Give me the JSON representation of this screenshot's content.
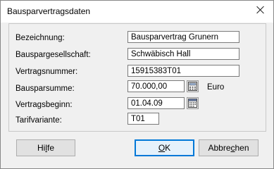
{
  "window": {
    "title": "Bausparvertragsdaten"
  },
  "fields": [
    {
      "label": "Bezeichnung:",
      "value": "Bausparvertrag Grunern"
    },
    {
      "label": "Bauspargesellschaft:",
      "value": "Schwäbisch Hall"
    },
    {
      "label": "Vertragsnummer:",
      "value": "15915383T01"
    },
    {
      "label": "Bausparsumme:",
      "value": "70.000,00",
      "unit": "Euro"
    },
    {
      "label": "Vertragsbeginn:",
      "value": "01.04.09"
    },
    {
      "label": "Tarifvariante:",
      "value": "T01"
    }
  ],
  "buttons": {
    "help": {
      "pre": "Hi",
      "key": "l",
      "post": "fe"
    },
    "ok": {
      "pre": "",
      "key": "O",
      "post": "K"
    },
    "cancel": {
      "pre": "Abbre",
      "key": "c",
      "post": "hen"
    }
  },
  "icons": {
    "close": "close-icon",
    "calculator": "calculator-icon",
    "calendar": "calendar-icon"
  },
  "colors": {
    "primary_border": "#0078d7"
  }
}
